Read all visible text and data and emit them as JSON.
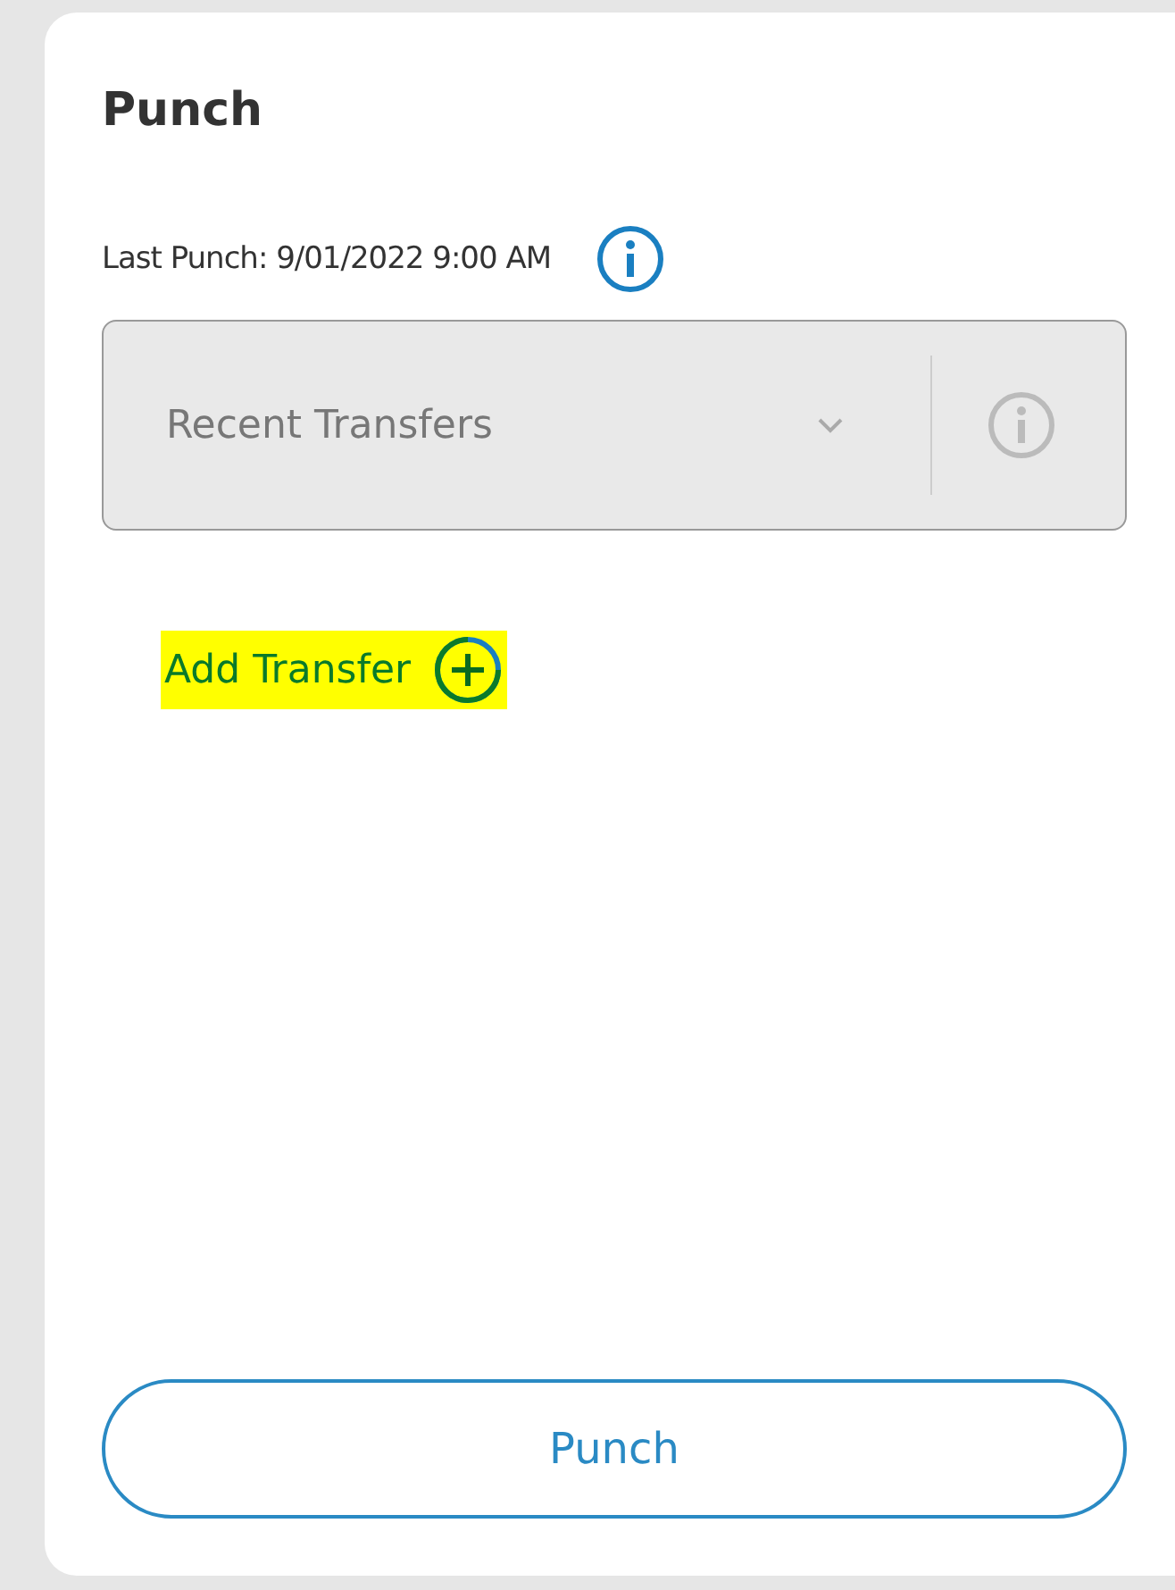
{
  "card": {
    "title": "Punch",
    "last_punch": "Last Punch: 9/01/2022 9:00 AM",
    "transfer_select": {
      "placeholder": "Recent Transfers",
      "disabled": true
    },
    "add_transfer": {
      "label": "Add Transfer",
      "highlighted": true
    },
    "punch_button": "Punch"
  }
}
